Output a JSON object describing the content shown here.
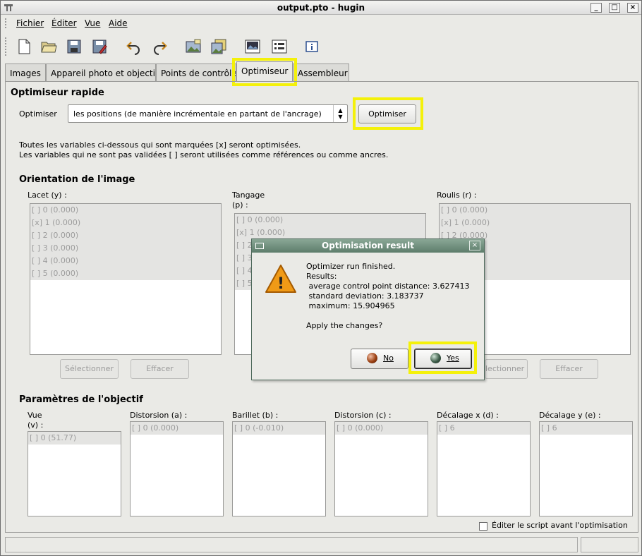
{
  "window": {
    "title": "output.pto - hugin",
    "minimize": "_",
    "maximize": "□",
    "close": "×"
  },
  "menu": {
    "items": [
      {
        "label": "Fichier",
        "mnemonic": "F"
      },
      {
        "label": "Éditer",
        "mnemonic": "É"
      },
      {
        "label": "Vue",
        "mnemonic": "V"
      },
      {
        "label": "Aide",
        "mnemonic": "A"
      }
    ]
  },
  "toolbar": {
    "icons": [
      "new-document-icon",
      "open-folder-icon",
      "save-icon",
      "save-as-icon",
      "undo-icon",
      "redo-icon",
      "add-images-icon",
      "add-series-icon",
      "preview-icon",
      "control-points-icon",
      "info-icon"
    ]
  },
  "tabs": [
    {
      "label": "Images"
    },
    {
      "label": "Appareil photo et objectif"
    },
    {
      "label": "Points de contrôle"
    },
    {
      "label": "Optimiseur",
      "active": true
    },
    {
      "label": "Assembleur"
    }
  ],
  "optimizer": {
    "section_title": "Optimiseur rapide",
    "label": "Optimiser",
    "combo_value": "les positions (de manière incrémentale en partant de l'ancrage)",
    "button": "Optimiser",
    "info_line1": "Toutes les variables ci-dessous qui sont marquées [x] seront optimisées.",
    "info_line2": "Les variables qui ne sont pas validées [ ] seront utilisées comme références ou comme ancres."
  },
  "orientation": {
    "title": "Orientation de l'image",
    "yaw": {
      "label": "Lacet (y) :",
      "items": [
        "[ ] 0 (0.000)",
        "[x] 1 (0.000)",
        "[ ] 2 (0.000)",
        "[ ] 3 (0.000)",
        "[ ] 4 (0.000)",
        "[ ] 5 (0.000)"
      ]
    },
    "pitch": {
      "label_line1": "Tangage",
      "label_line2": "(p) :",
      "items": [
        "[ ] 0 (0.000)",
        "[x] 1 (0.000)",
        "[ ] 2",
        "[ ] 3",
        "[ ] 4",
        "[ ] 5"
      ]
    },
    "roll": {
      "label": "Roulis (r) :",
      "items": [
        "[ ] 0 (0.000)",
        "[x] 1 (0.000)",
        "[ ] 2 (0.000)",
        "",
        "",
        ""
      ]
    },
    "select_button": "Sélectionner",
    "clear_button": "Effacer",
    "select_button_right": "lectionner",
    "clear_button_right": "Effacer"
  },
  "lens": {
    "title": "Paramètres de l'objectif",
    "columns": [
      {
        "label_line1": "Vue",
        "label_line2": "(v) :",
        "item": "[ ] 0 (51.77)"
      },
      {
        "label_line1": "Distorsion (a) :",
        "label_line2": "",
        "item": "[ ] 0 (0.000)"
      },
      {
        "label_line1": "Barillet (b) :",
        "label_line2": "",
        "item": "[ ] 0 (-0.010)"
      },
      {
        "label_line1": "Distorsion (c) :",
        "label_line2": "",
        "item": "[ ] 0 (0.000)"
      },
      {
        "label_line1": "Décalage x (d) :",
        "label_line2": "",
        "item": "[ ] 6"
      },
      {
        "label_line1": "Décalage y (e) :",
        "label_line2": "",
        "item": "[ ] 6"
      }
    ]
  },
  "edit_script": {
    "label": "Éditer le script avant l'optimisation",
    "checked": false
  },
  "dialog": {
    "title": "Optimisation result",
    "close": "×",
    "line1": "Optimizer run finished.",
    "line2": "Results:",
    "line3": " average control point distance: 3.627413",
    "line4": " standard deviation: 3.183737",
    "line5": " maximum: 15.904965",
    "question": "Apply the changes?",
    "no_button": "No",
    "yes_button": "Yes",
    "warning_glyph": "!"
  },
  "colors": {
    "highlight": "#f4f10a",
    "dialog_title": "#6a8a78",
    "window_bg": "#eaeae6"
  }
}
